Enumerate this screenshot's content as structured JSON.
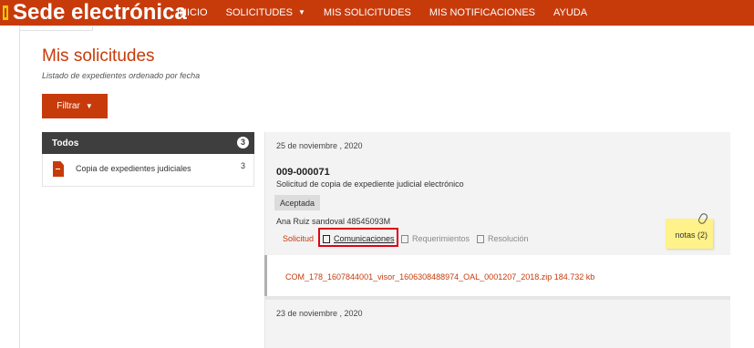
{
  "header": {
    "brand": "Sede electrónica",
    "nav": [
      "INICIO",
      "SOLICITUDES",
      "MIS SOLICITUDES",
      "MIS NOTIFICACIONES",
      "AYUDA"
    ],
    "brand_color": "#c73b0b"
  },
  "page": {
    "title": "Mis solicitudes",
    "subtitle": "Listado de expedientes ordenado por fecha",
    "filter_label": "Filtrar"
  },
  "left_panel": {
    "header_label": "Todos",
    "header_count": "3",
    "items": [
      {
        "label": "Copia de expedientes judiciales",
        "count": "3",
        "icon": "document-icon"
      }
    ]
  },
  "request": {
    "date": "25 de noviembre , 2020",
    "number": "009-000071",
    "description": "Solicitud de copia de expediente judicial electrónico",
    "status": "Aceptada",
    "person": "Ana Ruiz sandoval 48545093M",
    "tabs": [
      "Solicitud",
      "Comunicaciones",
      "Requerimientos",
      "Resolución"
    ],
    "notes_label": "notas (2)",
    "attachment": "COM_178_1607844001_visor_1606308488974_OAL_0001207_2018.zip 184.732 kb"
  },
  "next_request": {
    "date": "23 de noviembre , 2020"
  }
}
